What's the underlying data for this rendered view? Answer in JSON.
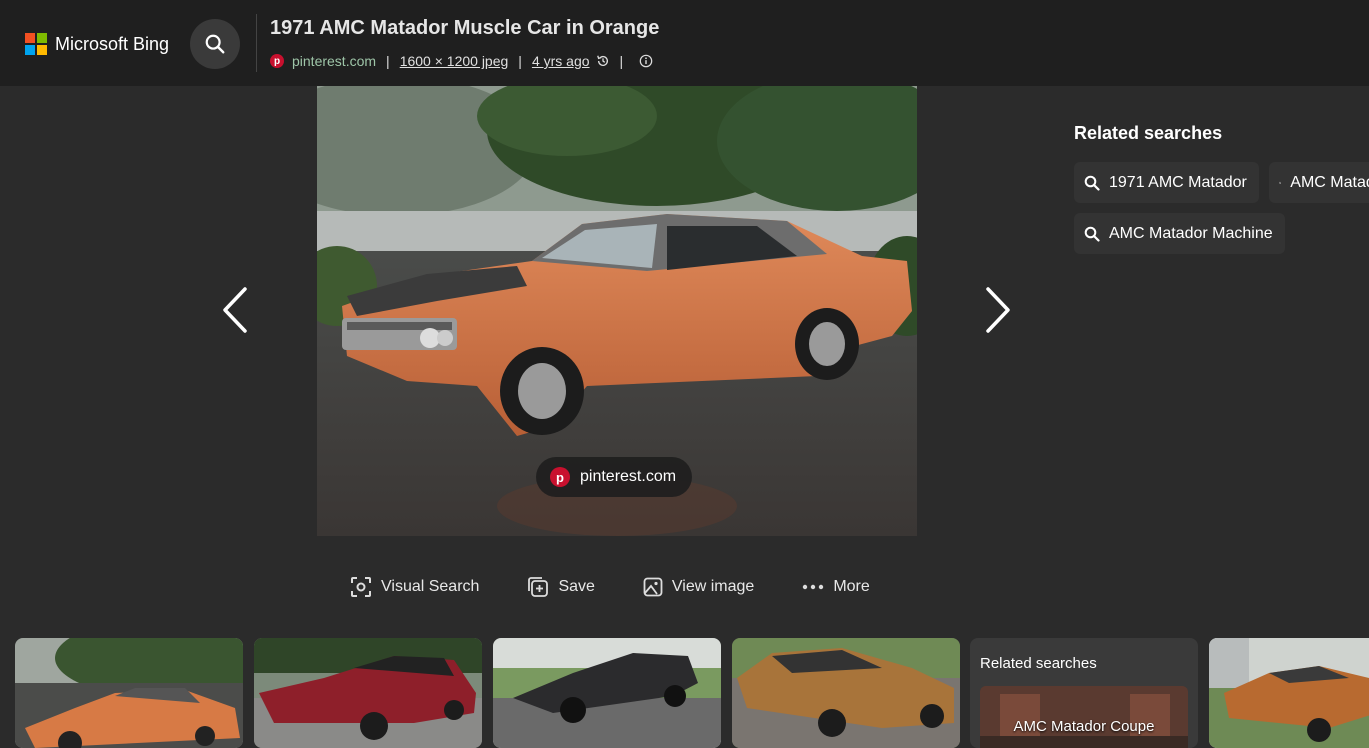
{
  "header": {
    "logo_text": "Microsoft Bing",
    "title": "1971 AMC Matador Muscle Car in Orange",
    "source": "pinterest.com",
    "dimensions": "1600 × 1200 jpeg",
    "age": "4 yrs ago",
    "separator": "|"
  },
  "image": {
    "overlay_source": "pinterest.com"
  },
  "actions": {
    "visual_search": "Visual Search",
    "save": "Save",
    "view_image": "View image",
    "more": "More"
  },
  "related": {
    "title": "Related searches",
    "chips": [
      "1971 AMC Matador",
      "AMC Matador",
      "AMC Matador Machine"
    ]
  },
  "strip": {
    "related_card_title": "Related searches",
    "related_card_label": "AMC Matador Coupe"
  },
  "colors": {
    "background": "#2b2b2b",
    "header_bg": "#1f1f1f",
    "pinterest_red": "#c8102e",
    "ms_red": "#f25022",
    "ms_green": "#7fba00",
    "ms_blue": "#00a4ef",
    "ms_yellow": "#ffb900"
  }
}
